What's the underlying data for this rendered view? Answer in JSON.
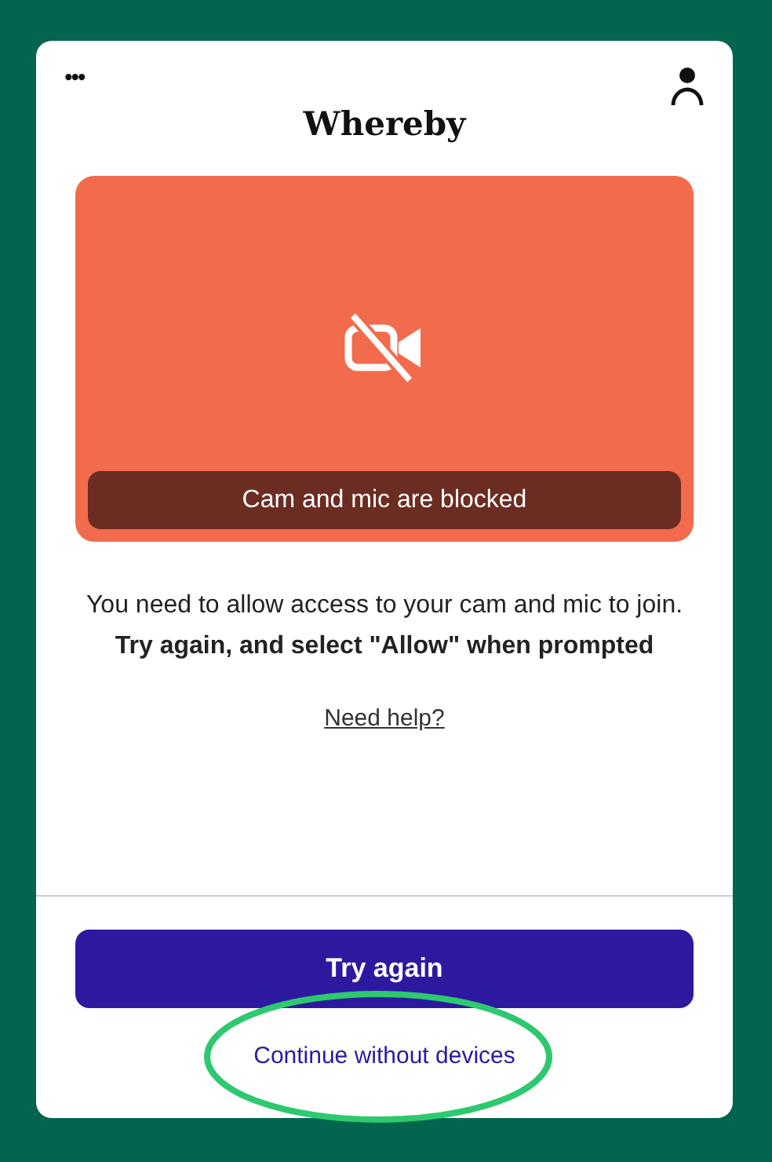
{
  "header": {
    "menu_icon": "•••",
    "logo": "Whereby"
  },
  "preview": {
    "status": "Cam and mic are blocked"
  },
  "message": "You need to allow access to your cam and mic to join. **Try again, and select \"Allow\" when prompted**",
  "help_link": "Need help?",
  "primary_button": "Try again",
  "secondary_link": "Continue without devices"
}
